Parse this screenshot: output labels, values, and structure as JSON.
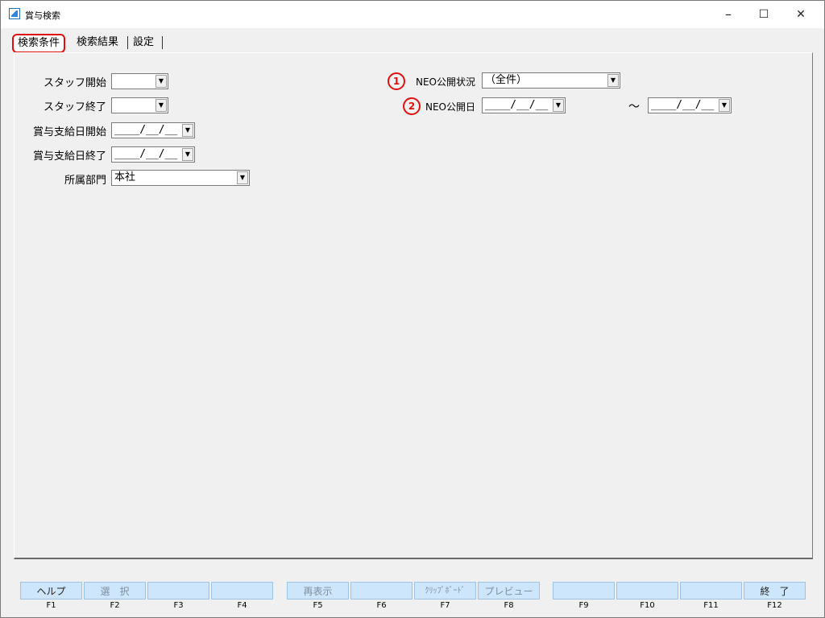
{
  "window": {
    "title": "賞与検索",
    "minimize": "–",
    "maximize": "☐",
    "close": "✕"
  },
  "tabs": [
    {
      "label": "検索条件",
      "active": true
    },
    {
      "label": "検索結果",
      "active": false
    },
    {
      "label": "設定",
      "active": false
    }
  ],
  "form": {
    "staff_start": {
      "label": "スタッフ開始",
      "value": ""
    },
    "staff_end": {
      "label": "スタッフ終了",
      "value": ""
    },
    "bonus_date_start": {
      "label": "賞与支給日開始",
      "value": "____/__/__"
    },
    "bonus_date_end": {
      "label": "賞与支給日終了",
      "value": "____/__/__"
    },
    "department": {
      "label": "所属部門",
      "value": "本社"
    },
    "neo_status": {
      "marker": "1",
      "label": "NEO公開状況",
      "value": "（全件）"
    },
    "neo_date": {
      "marker": "2",
      "label": "NEO公開日",
      "value_from": "____/__/__",
      "separator": "～",
      "value_to": "____/__/__"
    }
  },
  "function_keys": [
    {
      "label": "ヘルプ",
      "key": "F1",
      "enabled": true
    },
    {
      "label": "選　択",
      "key": "F2",
      "enabled": false
    },
    {
      "label": "",
      "key": "F3",
      "enabled": false
    },
    {
      "label": "",
      "key": "F4",
      "enabled": false
    },
    {
      "label": "再表示",
      "key": "F5",
      "enabled": false
    },
    {
      "label": "",
      "key": "F6",
      "enabled": false
    },
    {
      "label": "ｸﾘｯﾌﾟﾎﾞｰﾄﾞ",
      "key": "F7",
      "enabled": false
    },
    {
      "label": "プレビュー",
      "key": "F8",
      "enabled": false
    },
    {
      "label": "",
      "key": "F9",
      "enabled": false
    },
    {
      "label": "",
      "key": "F10",
      "enabled": false
    },
    {
      "label": "",
      "key": "F11",
      "enabled": false
    },
    {
      "label": "終　了",
      "key": "F12",
      "enabled": true
    }
  ]
}
